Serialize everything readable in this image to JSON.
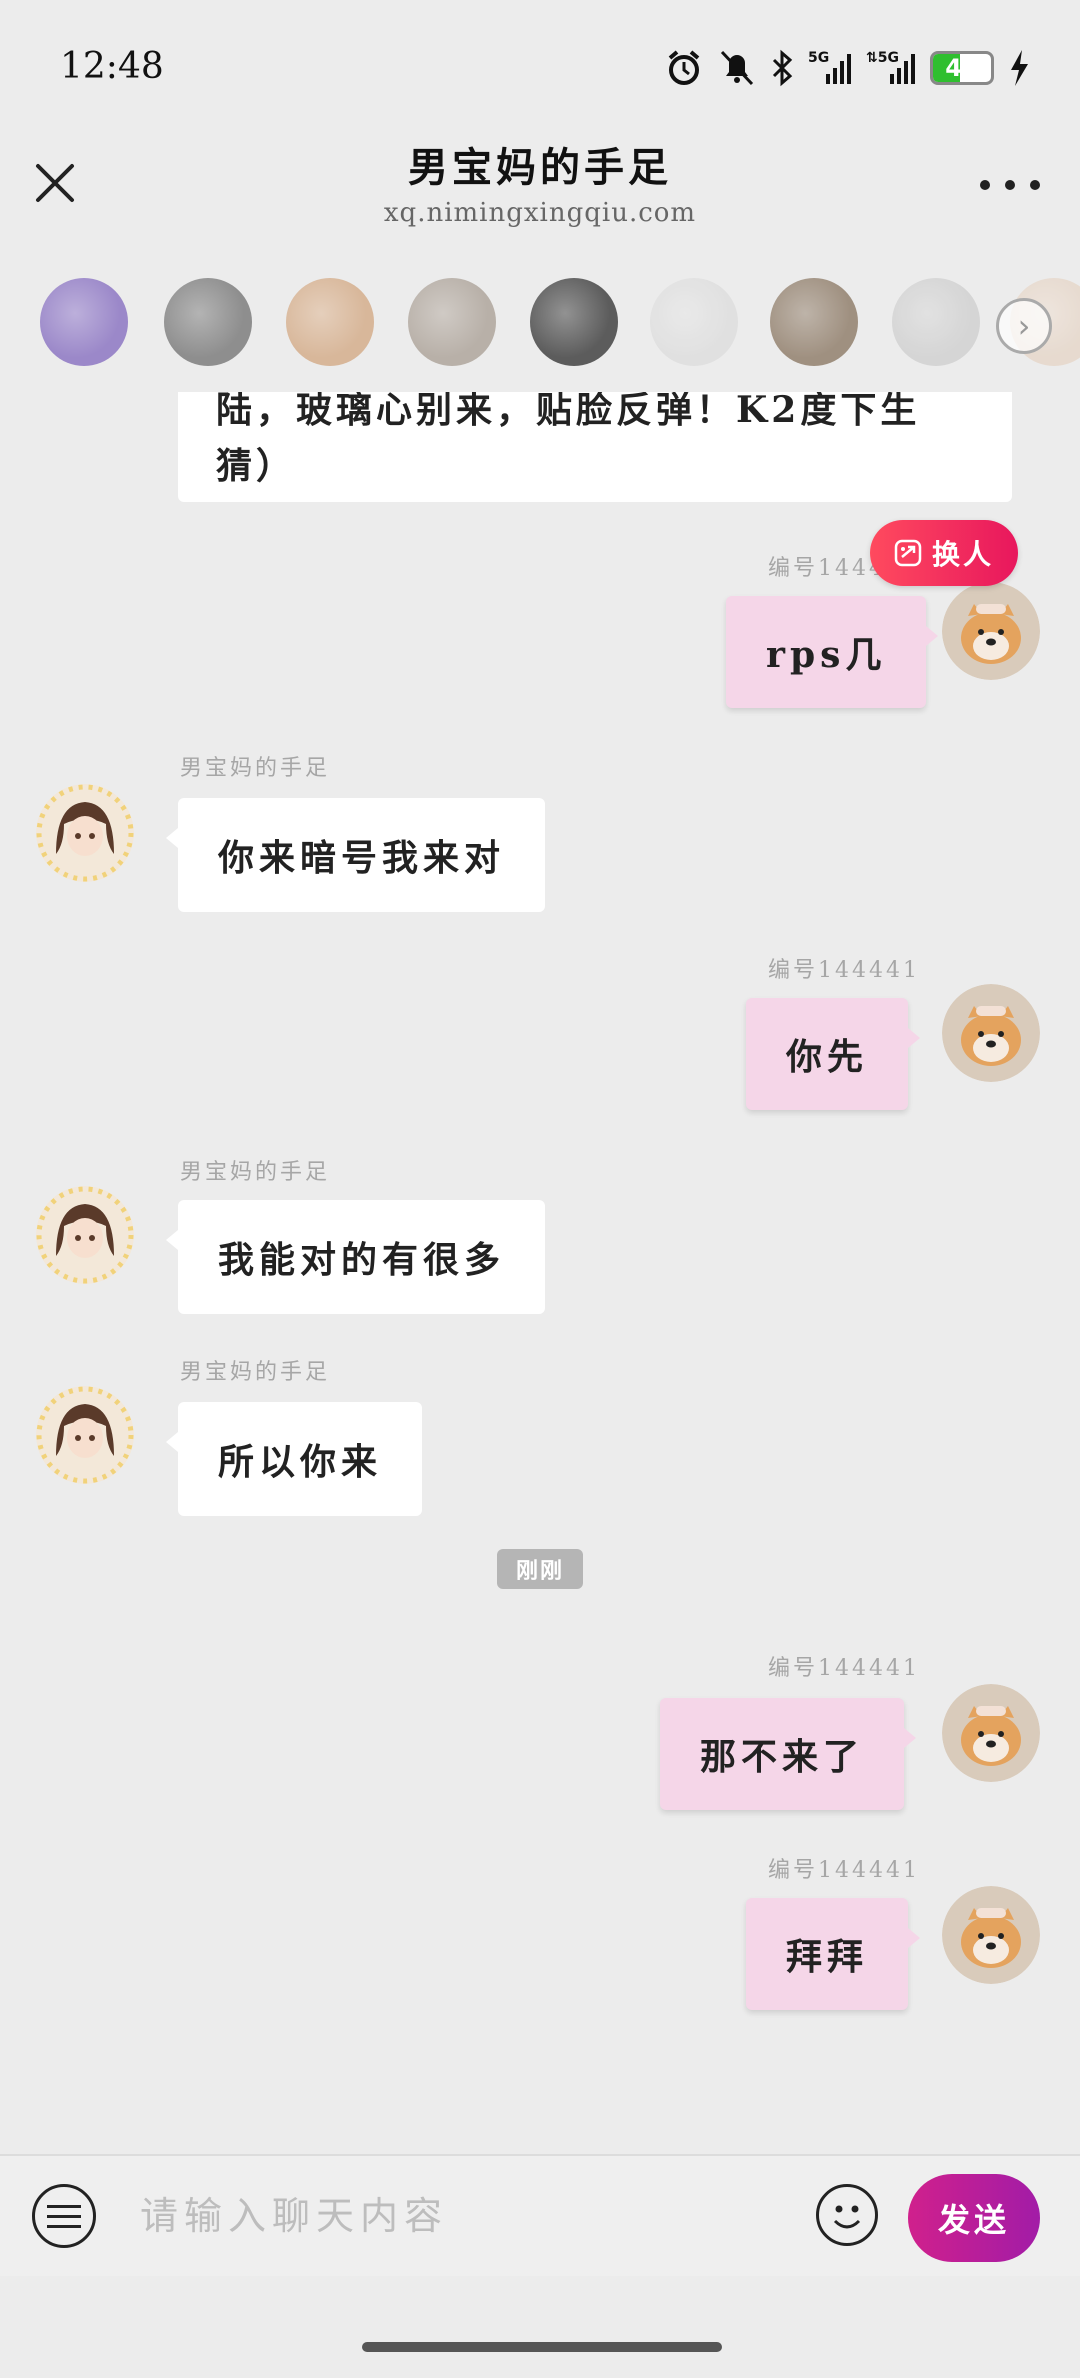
{
  "status_bar": {
    "time": "12:48",
    "battery": "46",
    "battery_level": 0.46,
    "network": "5G"
  },
  "header": {
    "title": "男宝妈的手足",
    "subtitle": "xq.nimingxingqiu.com"
  },
  "avatar_strip": {
    "items": [
      {
        "name": "planet-avatar",
        "color": "#9b88c9"
      },
      {
        "name": "bird-avatar",
        "color": "#8e8e8e"
      },
      {
        "name": "anime-girl-avatar",
        "color": "#d8b79a"
      },
      {
        "name": "cat-avatar",
        "color": "#b8b0a8"
      },
      {
        "name": "monochrome-avatar",
        "color": "#5c5c5c"
      },
      {
        "name": "snowman-avatar",
        "color": "#dedede"
      },
      {
        "name": "man-avatar",
        "color": "#8d7a66"
      },
      {
        "name": "penguin-avatar",
        "color": "#d0d0d0"
      },
      {
        "name": "cartoon-avatar",
        "color": "#e6d6c8"
      }
    ]
  },
  "chat": {
    "partial_message": {
      "line1": "陆，玻璃心别来，贴脸反弹！K2度下生",
      "line2": "猜）"
    },
    "swap_button": "换人",
    "time_divider": "刚刚",
    "messages": [
      {
        "dir": "out",
        "sender": "编号144441",
        "text": "rps几"
      },
      {
        "dir": "in",
        "sender": "男宝妈的手足",
        "text": "你来暗号我来对"
      },
      {
        "dir": "out",
        "sender": "编号144441",
        "text": "你先"
      },
      {
        "dir": "in",
        "sender": "男宝妈的手足",
        "text": "我能对的有很多"
      },
      {
        "dir": "in",
        "sender": "男宝妈的手足",
        "text": "所以你来"
      },
      {
        "dir": "out",
        "sender": "编号144441",
        "text": "那不来了"
      },
      {
        "dir": "out",
        "sender": "编号144441",
        "text": "拜拜"
      }
    ]
  },
  "input_bar": {
    "placeholder": "请输入聊天内容",
    "value": "",
    "send_label": "发送"
  },
  "colors": {
    "send": "#c01e98",
    "swap": "#f0305a",
    "outgoing_bubble": "#f5d6e8",
    "incoming_bubble": "#ffffff"
  }
}
